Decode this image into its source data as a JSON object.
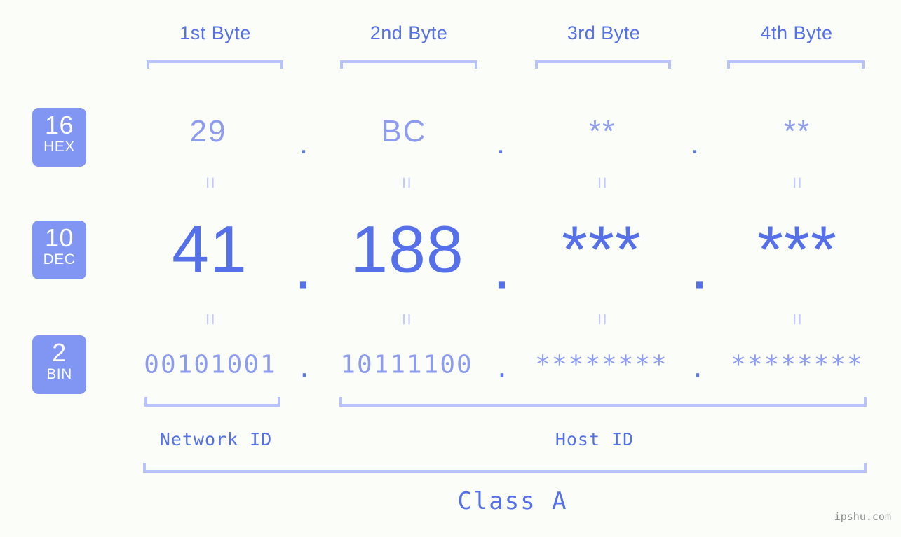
{
  "page": {
    "background_color": "#fbfdf8",
    "accent_color": "#5570e8",
    "muted_accent_color": "#8e9cf0",
    "bracket_color": "#b9c3fb",
    "badge_color": "#8096f2",
    "watermark": "ipshu.com"
  },
  "byte_headers": [
    {
      "label": "1st Byte"
    },
    {
      "label": "2nd Byte"
    },
    {
      "label": "3rd Byte"
    },
    {
      "label": "4th Byte"
    }
  ],
  "radix_badges": [
    {
      "number": "16",
      "name": "HEX"
    },
    {
      "number": "10",
      "name": "DEC"
    },
    {
      "number": "2",
      "name": "BIN"
    }
  ],
  "rows": {
    "hex": {
      "octets": [
        "29",
        "BC",
        "**",
        "**"
      ],
      "separator": "."
    },
    "dec": {
      "octets": [
        "41",
        "188",
        "***",
        "***"
      ],
      "separator": "."
    },
    "bin": {
      "octets": [
        "00101001",
        "10111100",
        "********",
        "********"
      ],
      "separator": "."
    }
  },
  "equality_marks": {
    "symbol": "=",
    "rows": [
      "hex-to-dec",
      "dec-to-bin"
    ]
  },
  "segments": {
    "network_id": "Network ID",
    "host_id": "Host ID",
    "class": "Class A"
  }
}
